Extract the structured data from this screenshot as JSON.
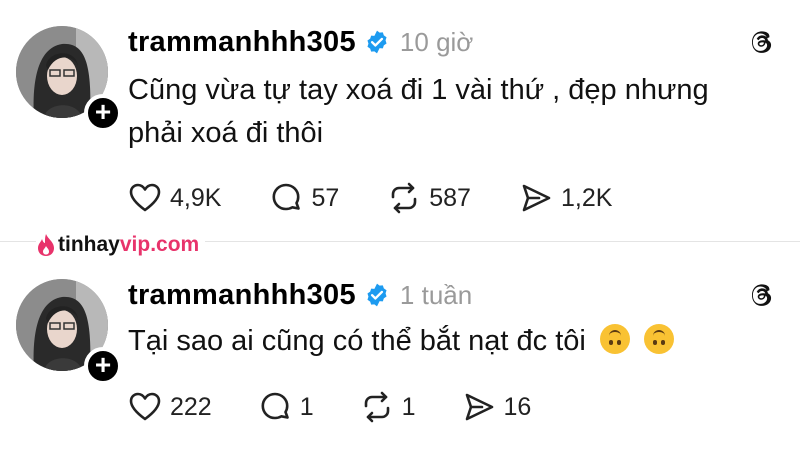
{
  "posts": [
    {
      "username": "trammanhhh305",
      "time": "10 giờ",
      "text_lines": [
        "Cũng vừa tự tay xoá đi 1 vài thứ , đẹp nhưng",
        "phải xoá đi thôi"
      ],
      "likes": "4,9K",
      "replies": "57",
      "reposts": "587",
      "shares": "1,2K"
    },
    {
      "username": "trammanhhh305",
      "time": "1 tuần",
      "text": "Tại sao ai cũng có thể bắt nạt đc tôi",
      "emojis": [
        "upside-down-face",
        "upside-down-face"
      ],
      "likes": "222",
      "replies": "1",
      "reposts": "1",
      "shares": "16"
    }
  ],
  "watermark": {
    "brand_part1": "tinhay",
    "brand_part2": "vip",
    "brand_part3": ".com"
  },
  "colors": {
    "verified": "#1d9bf0",
    "time": "#9a9a9a",
    "watermark_red": "#e8336b"
  },
  "icons": [
    "verified-badge-icon",
    "threads-logo-icon",
    "heart-icon",
    "comment-icon",
    "repost-icon",
    "share-icon",
    "flame-icon"
  ]
}
